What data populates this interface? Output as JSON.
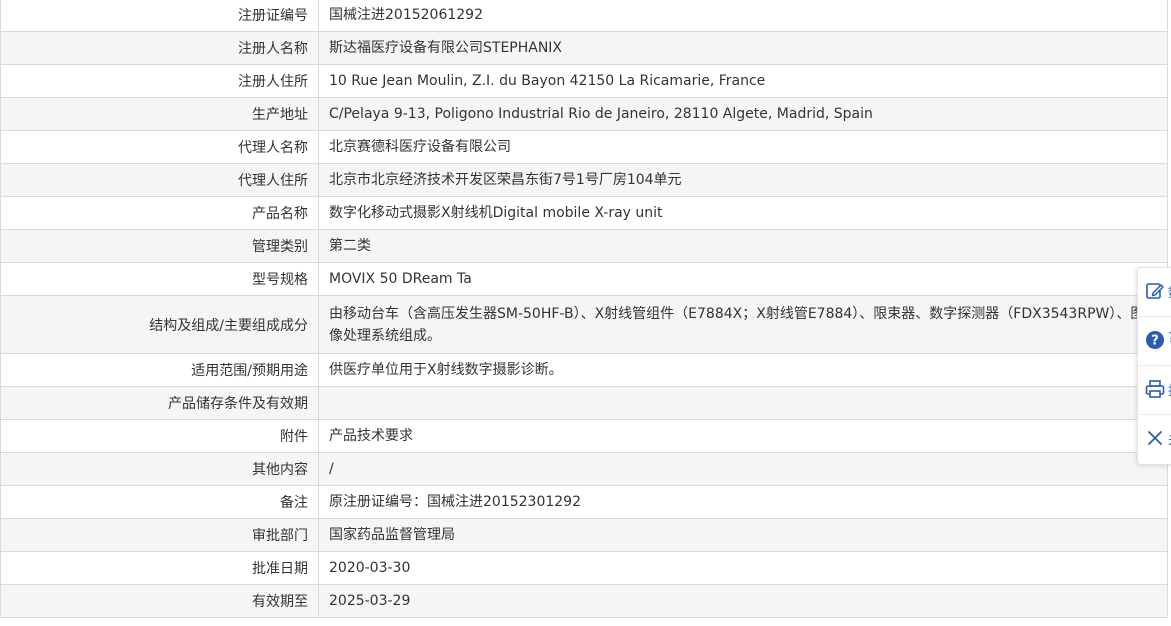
{
  "rows": [
    {
      "label": "注册证编号",
      "value": "国械注进20152061292"
    },
    {
      "label": "注册人名称",
      "value": "斯达福医疗设备有限公司STEPHANIX"
    },
    {
      "label": "注册人住所",
      "value": "10 Rue Jean Moulin, Z.I. du Bayon 42150 La Ricamarie, France"
    },
    {
      "label": "生产地址",
      "value": "C/Pelaya 9-13, Poligono Industrial Rio de Janeiro, 28110 Algete, Madrid, Spain"
    },
    {
      "label": "代理人名称",
      "value": "北京赛德科医疗设备有限公司"
    },
    {
      "label": "代理人住所",
      "value": "北京市北京经济技术开发区荣昌东街7号1号厂房104单元"
    },
    {
      "label": "产品名称",
      "value": "数字化移动式摄影X射线机Digital mobile X-ray unit"
    },
    {
      "label": "管理类别",
      "value": "第二类"
    },
    {
      "label": "型号规格",
      "value": "MOVIX 50 DReam Ta"
    },
    {
      "label": "结构及组成/主要组成成分",
      "value": "由移动台车（含高压发生器SM-50HF-B）、X射线管组件（E7884X；X射线管E7884）、限束器、数字探测器（FDX3543RPW）、图像处理系统组成。"
    },
    {
      "label": "适用范围/预期用途",
      "value": "供医疗单位用于X射线数字摄影诊断。"
    },
    {
      "label": "产品储存条件及有效期",
      "value": ""
    },
    {
      "label": "附件",
      "value": "产品技术要求"
    },
    {
      "label": "其他内容",
      "value": "/"
    },
    {
      "label": "备注",
      "value": "原注册证编号：国械注进20152301292"
    },
    {
      "label": "审批部门",
      "value": "国家药品监督管理局"
    },
    {
      "label": "批准日期",
      "value": "2020-03-30"
    },
    {
      "label": "有效期至",
      "value": "2025-03-29"
    }
  ],
  "float_bar": {
    "items": [
      {
        "icon": "edit-icon",
        "text": "数"
      },
      {
        "icon": "help-icon",
        "text": "?"
      },
      {
        "icon": "print-icon",
        "text": "打"
      },
      {
        "icon": "close-icon",
        "text": "关"
      }
    ],
    "accent": "#2a5db0"
  }
}
